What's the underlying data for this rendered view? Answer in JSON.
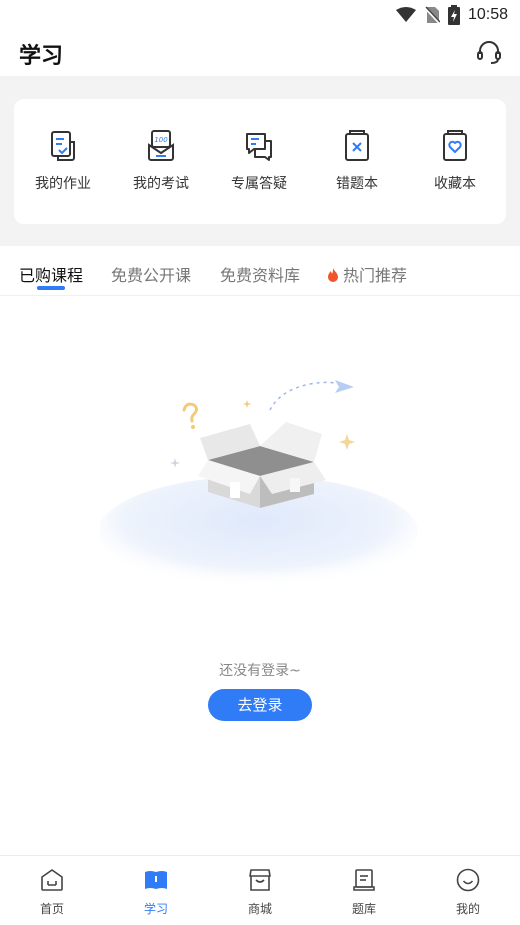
{
  "status_bar": {
    "time": "10:58"
  },
  "header": {
    "title": "学习"
  },
  "quick_actions": [
    {
      "label": "我的作业",
      "icon": "homework-icon"
    },
    {
      "label": "我的考试",
      "icon": "exam-icon"
    },
    {
      "label": "专属答疑",
      "icon": "qa-chat-icon"
    },
    {
      "label": "错题本",
      "icon": "mistake-book-icon"
    },
    {
      "label": "收藏本",
      "icon": "favorites-icon"
    }
  ],
  "tabs": [
    {
      "label": "已购课程",
      "active": true
    },
    {
      "label": "免费公开课",
      "active": false
    },
    {
      "label": "免费资料库",
      "active": false
    },
    {
      "label": "热门推荐",
      "active": false,
      "icon": "fire-icon"
    }
  ],
  "empty_state": {
    "message": "还没有登录~",
    "button_label": "去登录"
  },
  "bottom_nav": [
    {
      "label": "首页",
      "icon": "home-icon",
      "active": false
    },
    {
      "label": "学习",
      "icon": "study-book-icon",
      "active": true
    },
    {
      "label": "商城",
      "icon": "store-icon",
      "active": false
    },
    {
      "label": "题库",
      "icon": "question-bank-icon",
      "active": false
    },
    {
      "label": "我的",
      "icon": "profile-smile-icon",
      "active": false
    }
  ],
  "colors": {
    "accent": "#2f7cf6",
    "background_gray": "#f3f3f3",
    "fire": "#f0542d"
  }
}
